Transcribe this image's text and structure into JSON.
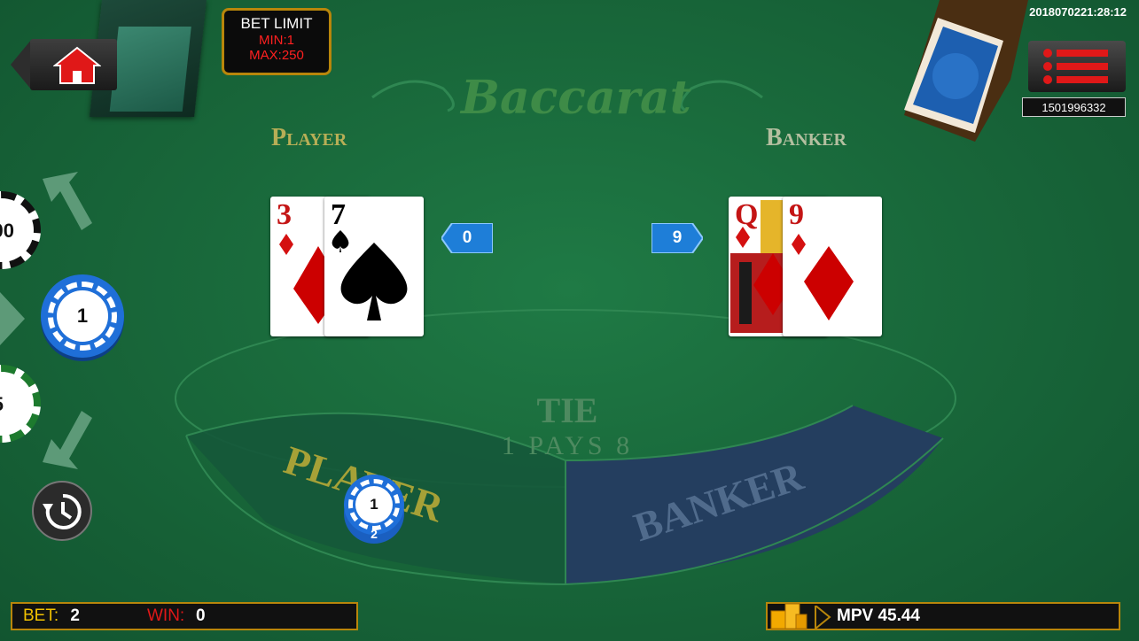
{
  "header": {
    "bet_limit_title": "BET LIMIT",
    "bet_limit_min": "MIN:1",
    "bet_limit_max": "MAX:250",
    "timestamp": "2018070221:28:12",
    "round_id": "1501996332"
  },
  "table": {
    "title": "Baccarat",
    "player_label": "Player",
    "banker_label": "Banker",
    "tie_label": "TIE",
    "tie_payout": "1 PAYS 8",
    "player_zone_label": "PLAYER",
    "banker_zone_label": "BANKER"
  },
  "player_hand": {
    "score": "0",
    "cards": [
      {
        "rank": "3",
        "suit": "diamonds"
      },
      {
        "rank": "7",
        "suit": "spades"
      }
    ]
  },
  "banker_hand": {
    "score": "9",
    "cards": [
      {
        "rank": "Q",
        "suit": "diamonds"
      },
      {
        "rank": "9",
        "suit": "diamonds"
      }
    ]
  },
  "chips": {
    "top_partial": "00",
    "selected": "1",
    "bottom_partial": "5"
  },
  "placed_bet": {
    "chip_value": "1",
    "stack_count": "2"
  },
  "footer": {
    "bet_label": "BET:",
    "bet_value": "2",
    "win_label": "WIN:",
    "win_value": "0",
    "balance_text": "MPV 45.44"
  },
  "colors": {
    "felt": "#19693b",
    "gold_border": "#b8860b",
    "limit_text": "#ff2020",
    "banker_zone": "#243e5f",
    "chip_blue": "#1f6fd8"
  }
}
